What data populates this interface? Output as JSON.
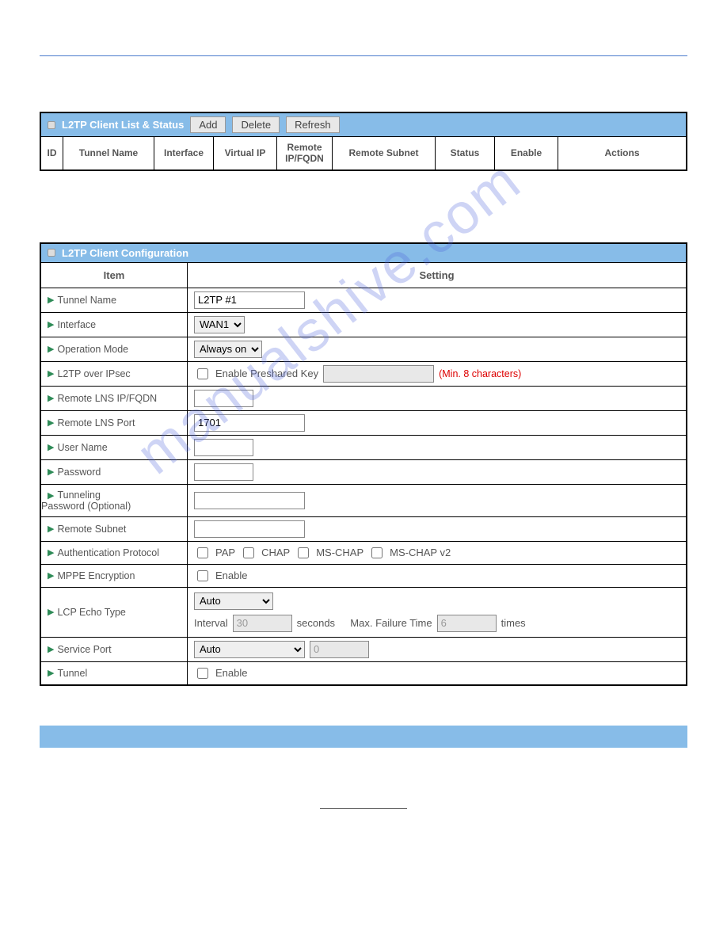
{
  "watermark": "manualshive.com",
  "list_panel": {
    "title": "L2TP Client List & Status",
    "buttons": {
      "add": "Add",
      "delete": "Delete",
      "refresh": "Refresh"
    },
    "columns": {
      "id": "ID",
      "tunnel_name": "Tunnel Name",
      "interface": "Interface",
      "virtual_ip": "Virtual IP",
      "remote_ip": "Remote IP/FQDN",
      "remote_subnet": "Remote Subnet",
      "status": "Status",
      "enable": "Enable",
      "actions": "Actions"
    }
  },
  "config_panel": {
    "title": "L2TP Client Configuration",
    "head": {
      "item": "Item",
      "setting": "Setting"
    },
    "rows": {
      "tunnel_name": {
        "label": "Tunnel Name",
        "value": "L2TP #1"
      },
      "interface": {
        "label": "Interface",
        "value": "WAN1"
      },
      "operation_mode": {
        "label": "Operation Mode",
        "value": "Always on"
      },
      "l2tp_ipsec": {
        "label": "L2TP over IPsec",
        "enable_text": "Enable Preshared Key",
        "hint": "(Min. 8 characters)"
      },
      "remote_lns_ip": {
        "label": "Remote LNS IP/FQDN",
        "value": ""
      },
      "remote_lns_port": {
        "label": "Remote LNS Port",
        "value": "1701"
      },
      "user_name": {
        "label": "User Name",
        "value": ""
      },
      "password": {
        "label": "Password",
        "value": ""
      },
      "tunneling_password": {
        "label_line1": "Tunneling",
        "label_line2": "Password (Optional)",
        "value": ""
      },
      "remote_subnet": {
        "label": "Remote Subnet",
        "value": ""
      },
      "auth_protocol": {
        "label": "Authentication Protocol",
        "pap": "PAP",
        "chap": "CHAP",
        "mschap": "MS-CHAP",
        "mschapv2": "MS-CHAP v2"
      },
      "mppe": {
        "label": "MPPE Encryption",
        "enable_text": "Enable"
      },
      "lcp_echo": {
        "label": "LCP Echo Type",
        "mode": "Auto",
        "interval_label": "Interval",
        "interval_value": "30",
        "seconds_label": "seconds",
        "maxfail_label": "Max. Failure Time",
        "maxfail_value": "6",
        "times_label": "times"
      },
      "service_port": {
        "label": "Service Port",
        "mode": "Auto",
        "value": "0"
      },
      "tunnel": {
        "label": "Tunnel",
        "enable_text": "Enable"
      }
    }
  }
}
